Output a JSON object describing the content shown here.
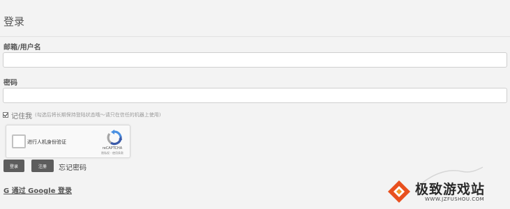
{
  "page": {
    "title": "登录"
  },
  "form": {
    "username_label": "邮箱/用户名",
    "username_value": "",
    "password_label": "密码",
    "password_value": "",
    "remember_label": "记住我",
    "remember_checked": true,
    "remember_hint": "(勾选后将长期保持登陆状态哦～请只在信任的机器上使用)"
  },
  "captcha": {
    "label": "进行人机身份验证",
    "brand": "reCAPTCHA",
    "links": "隐私权 - 使用条款"
  },
  "buttons": {
    "login": "登录",
    "register": "注册",
    "forgot": "忘记密码"
  },
  "google": {
    "label": "G 通过 Google 登录"
  },
  "watermark": {
    "text": "极致游戏站",
    "url": "WWW.JZFUSHOU.COM",
    "accent": "#e8501e"
  }
}
